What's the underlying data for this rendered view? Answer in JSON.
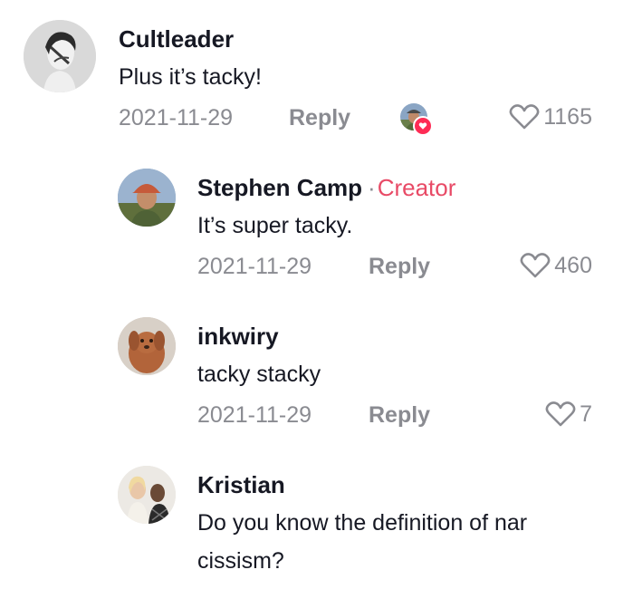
{
  "comments": [
    {
      "username": "Cultleader",
      "text": "Plus it’s tacky!",
      "date": "2021-11-29",
      "reply_label": "Reply",
      "likes": "1165",
      "liked_by_creator": true
    },
    {
      "username": "Stephen Camp",
      "separator": "·",
      "creator_label": "Creator",
      "text": "It’s super tacky.",
      "date": "2021-11-29",
      "reply_label": "Reply",
      "likes": "460"
    },
    {
      "username": "inkwiry",
      "text": "tacky stacky",
      "date": "2021-11-29",
      "reply_label": "Reply",
      "likes": "7"
    },
    {
      "username": "Kristian",
      "text_line1": "Do you know the definition of nar",
      "text_line2": "cissism?"
    }
  ],
  "colors": {
    "text": "#161823",
    "muted": "#8a8b91",
    "creator": "#e84a66",
    "heart_badge": "#fe2c55"
  },
  "icons": [
    "heart-outline-icon",
    "heart-badge-icon"
  ]
}
